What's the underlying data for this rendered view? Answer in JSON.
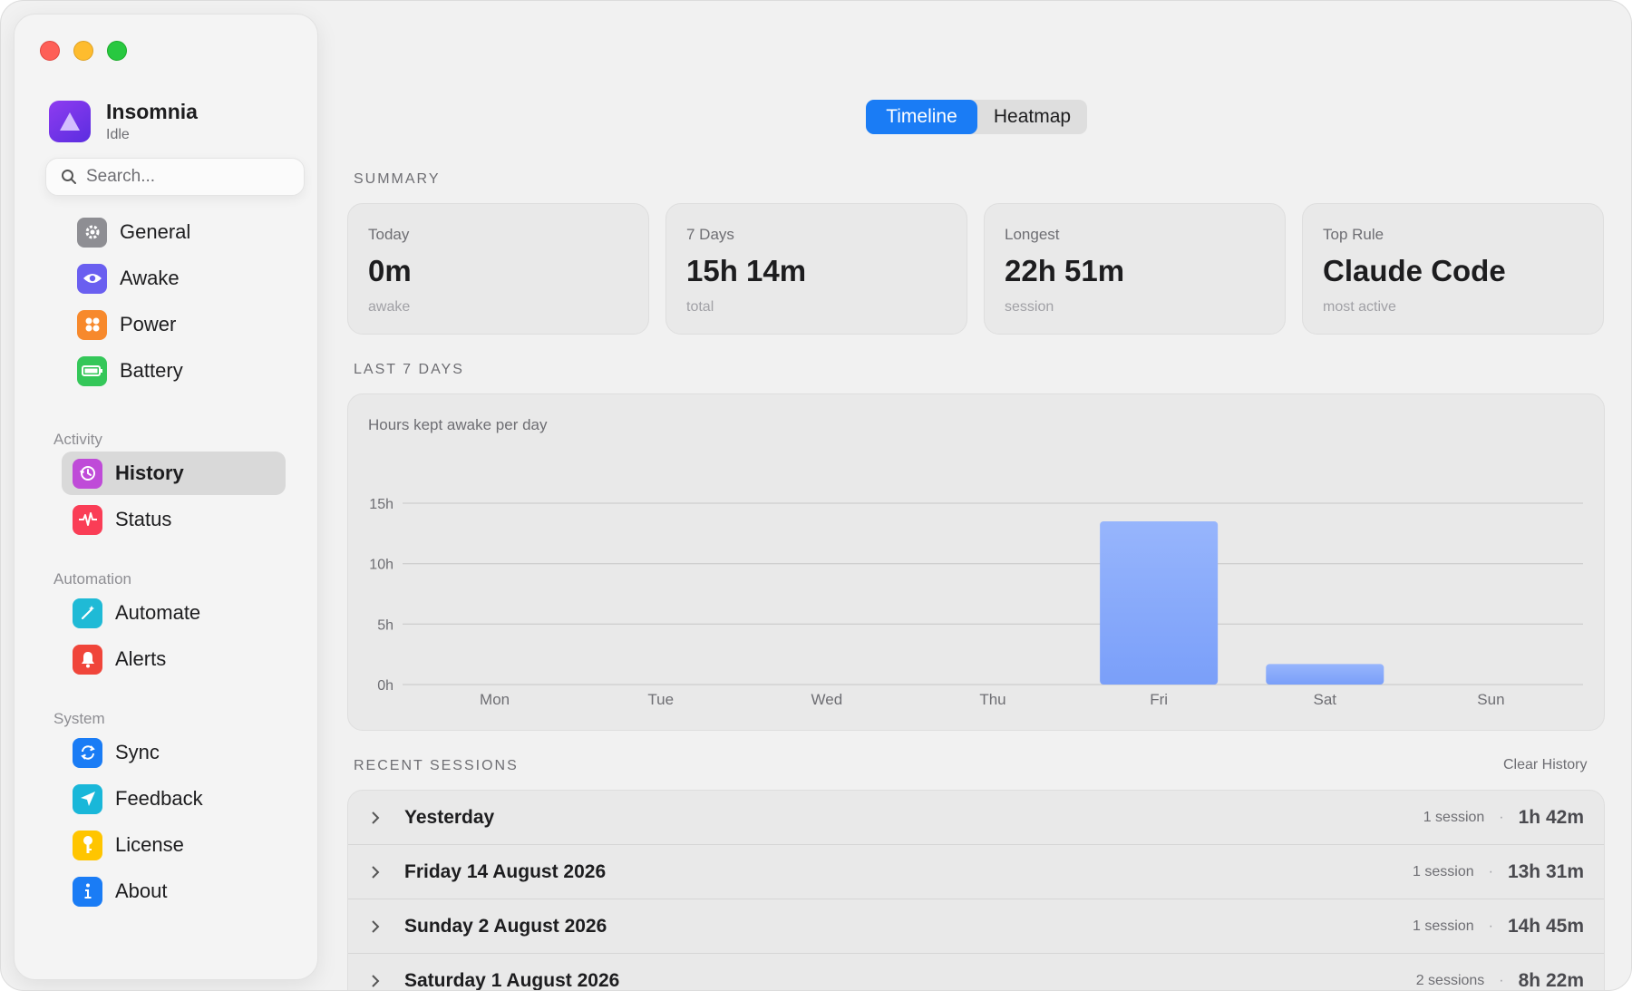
{
  "app": {
    "name": "Insomnia",
    "status": "Idle"
  },
  "search": {
    "placeholder": "Search..."
  },
  "sidebar": {
    "items_top": [
      {
        "label": "General",
        "icon": "gear-icon",
        "color": "#8e8e93"
      },
      {
        "label": "Awake",
        "icon": "eye-icon",
        "color": "#6a5ff0"
      },
      {
        "label": "Power",
        "icon": "power-icon",
        "color": "#f7892c"
      },
      {
        "label": "Battery",
        "icon": "battery-icon",
        "color": "#34c759"
      }
    ],
    "activity_header": "Activity",
    "activity_items": [
      {
        "label": "History",
        "icon": "history-icon",
        "color": "#bf4bd8",
        "active": true
      },
      {
        "label": "Status",
        "icon": "pulse-icon",
        "color": "#fa3d56"
      }
    ],
    "automation_header": "Automation",
    "automation_items": [
      {
        "label": "Automate",
        "icon": "wand-icon",
        "color": "#1fbad6"
      },
      {
        "label": "Alerts",
        "icon": "bell-icon",
        "color": "#f0453a"
      }
    ],
    "system_header": "System",
    "system_items": [
      {
        "label": "Sync",
        "icon": "sync-icon",
        "color": "#1a7cf5"
      },
      {
        "label": "Feedback",
        "icon": "send-icon",
        "color": "#19b7d9"
      },
      {
        "label": "License",
        "icon": "key-icon",
        "color": "#ffc500"
      },
      {
        "label": "About",
        "icon": "info-icon",
        "color": "#1a7cf5"
      }
    ]
  },
  "tabs": {
    "timeline": "Timeline",
    "heatmap": "Heatmap",
    "active": "Timeline"
  },
  "summary": {
    "label": "SUMMARY",
    "cards": [
      {
        "title": "Today",
        "value": "0m",
        "sub": "awake"
      },
      {
        "title": "7 Days",
        "value": "15h 14m",
        "sub": "total"
      },
      {
        "title": "Longest",
        "value": "22h 51m",
        "sub": "session"
      },
      {
        "title": "Top Rule",
        "value": "Claude Code",
        "sub": "most active"
      }
    ]
  },
  "last7": {
    "label": "LAST 7 DAYS"
  },
  "chart_data": {
    "type": "bar",
    "title": "Hours kept awake per day",
    "categories": [
      "Mon",
      "Tue",
      "Wed",
      "Thu",
      "Fri",
      "Sat",
      "Sun"
    ],
    "values": [
      0,
      0,
      0,
      0,
      13.5,
      1.7,
      0
    ],
    "yticks": [
      "0h",
      "5h",
      "10h",
      "15h"
    ],
    "ylim": [
      0,
      15
    ],
    "grid": true,
    "bar_color": "#86a9fb"
  },
  "sessions": {
    "label": "RECENT SESSIONS",
    "clear_label": "Clear History",
    "rows": [
      {
        "title": "Yesterday",
        "count": "1 session",
        "duration": "1h 42m"
      },
      {
        "title": "Friday 14 August 2026",
        "count": "1 session",
        "duration": "13h 31m"
      },
      {
        "title": "Sunday 2 August 2026",
        "count": "1 session",
        "duration": "14h 45m"
      },
      {
        "title": "Saturday 1 August 2026",
        "count": "2 sessions",
        "duration": "8h 22m"
      }
    ],
    "separator": "·"
  }
}
